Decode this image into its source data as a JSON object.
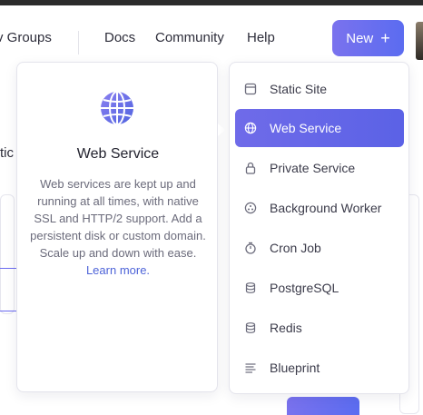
{
  "header": {
    "nav": [
      "v Groups",
      "Docs",
      "Community",
      "Help"
    ],
    "new_button": "New",
    "new_icon": "plus-icon"
  },
  "background": {
    "left_text": "tic r"
  },
  "info_card": {
    "icon": "globe-icon",
    "title": "Web Service",
    "description": "Web services are kept up and running at all times, with native SSL and HTTP/2 support. Add a persistent disk or custom domain. Scale up and down with ease.",
    "link": "Learn more."
  },
  "menu": {
    "items": [
      {
        "label": "Static Site",
        "icon": "static-site-icon",
        "active": false
      },
      {
        "label": "Web Service",
        "icon": "globe-icon",
        "active": true
      },
      {
        "label": "Private Service",
        "icon": "lock-icon",
        "active": false
      },
      {
        "label": "Background Worker",
        "icon": "worker-icon",
        "active": false
      },
      {
        "label": "Cron Job",
        "icon": "stopwatch-icon",
        "active": false
      },
      {
        "label": "PostgreSQL",
        "icon": "database-icon",
        "active": false
      },
      {
        "label": "Redis",
        "icon": "database-icon",
        "active": false
      },
      {
        "label": "Blueprint",
        "icon": "blueprint-icon",
        "active": false
      }
    ]
  },
  "colors": {
    "accent": "#5b62e6",
    "accent_light": "#7a72ee",
    "link": "#4d63d8"
  }
}
